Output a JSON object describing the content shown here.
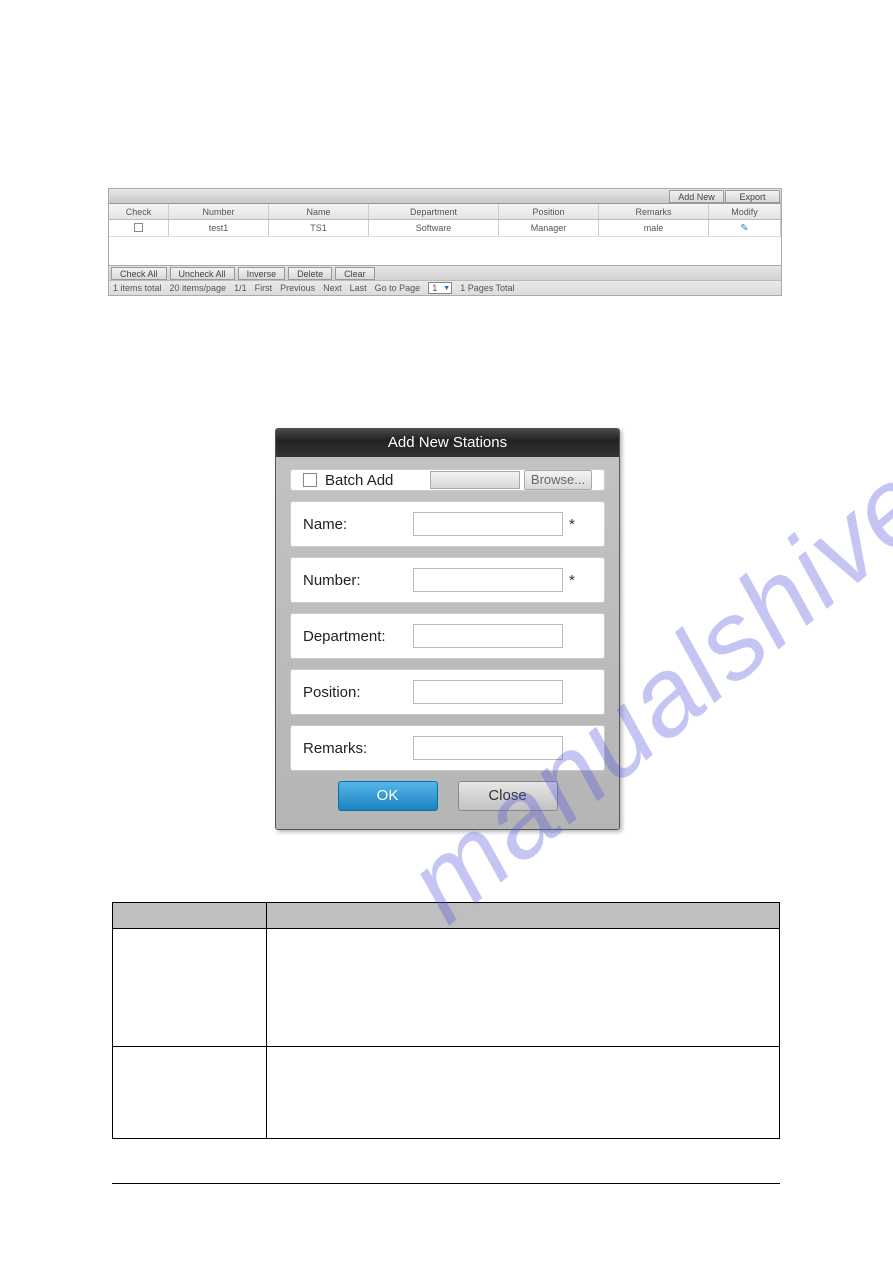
{
  "watermark": "manualshive.com",
  "toolbar": {
    "addnew_label": "Add New",
    "export_label": "Export"
  },
  "grid": {
    "headers": {
      "check": "Check",
      "number": "Number",
      "name": "Name",
      "department": "Department",
      "position": "Position",
      "remarks": "Remarks",
      "modify": "Modify"
    },
    "rows": [
      {
        "number": "test1",
        "name": "TS1",
        "department": "Software",
        "position": "Manager",
        "remarks": "male"
      }
    ]
  },
  "actions": {
    "checkall": "Check All",
    "uncheckall": "Uncheck All",
    "inverse": "Inverse",
    "delete": "Delete",
    "clear": "Clear"
  },
  "pager": {
    "items_total": "1 items total",
    "items_per_page": "20 items/page",
    "page_of": "1/1",
    "first": "First",
    "previous": "Previous",
    "next": "Next",
    "last": "Last",
    "gotopage": "Go to Page",
    "page_value": "1",
    "pages_total": "1 Pages Total"
  },
  "dialog": {
    "title": "Add New Stations",
    "batch_label": "Batch Add",
    "browse_label": "Browse...",
    "name_label": "Name:",
    "number_label": "Number:",
    "department_label": "Department:",
    "position_label": "Position:",
    "remarks_label": "Remarks:",
    "ok_label": "OK",
    "close_label": "Close",
    "required_marker": "*"
  }
}
